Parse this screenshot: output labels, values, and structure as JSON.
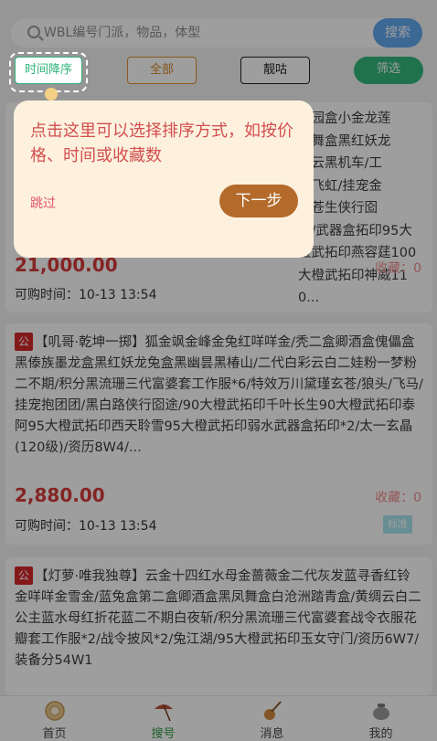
{
  "search": {
    "placeholder": "WBL编号门派，物品，体型",
    "button_label": "搜索"
  },
  "filters": {
    "time_desc": "时间降序",
    "all": "全部",
    "price": "靓咕",
    "screen": "筛选"
  },
  "cards": [
    {
      "title_visible": "游园盒小金龙莲\n圆舞盒黑红妖龙\n水云黑机车/工\n兔飞虹/挂宠金\n济苍生侠行囵\n返/武器盒拓印95大橙武拓印燕容莛100大橙武拓印神威110...",
      "price": "21,000.00",
      "collect": "收藏：0",
      "buy_time": "可购时间：10-13 13:54"
    },
    {
      "tag": "公",
      "title": "【叽哥·乾坤一掷】狐金飒金峰金兔红咩咩金/秃二盒卿酒盒傀儡盒黑傣族墨龙盒黑红妖龙兔盒黑幽昙黑椿山/二代白彩云白二娃粉一梦粉二不期/积分黑流珊三代富婆套工作服*6/特效万川黛瑾玄苍/狼头/飞马/挂宠抱团团/黑白路侠行囵途/90大橙武拓印千叶长生90大橙武拓印泰阿95大橙武拓印西天聆雪95大橙武拓印弱水武器盒拓印*2/太一玄晶(120级)/资历8W4/...",
      "price": "2,880.00",
      "collect": "收藏：0",
      "buy_time": "可购时间：10-13 13:54",
      "badge": "标准"
    },
    {
      "tag": "公",
      "title": "【灯萝·唯我独尊】云金十四红水母金蔷薇金二代灰发蓝寻香红铃金咩咩金雪金/蓝兔盒第二盒卿酒盒黑凤舞盒白沧洲踏青盒/黄绸云白二公主蓝水母红折花蓝二不期白夜斩/积分黑流珊三代富婆套战令衣服花瓣套工作服*2/战令披风*2/兔江湖/95大橙武拓印玉女守门/资历6W7/装备分54W1"
    }
  ],
  "guide": {
    "text": "点击这里可以选择排序方式，如按价格、时间或收藏数",
    "skip": "跳过",
    "next": "下一步"
  },
  "tabbar": {
    "items": [
      {
        "label": "首页",
        "icon": "home-coin-icon"
      },
      {
        "label": "搜号",
        "icon": "umbrella-icon",
        "active": true
      },
      {
        "label": "消息",
        "icon": "pipa-icon"
      },
      {
        "label": "我的",
        "icon": "pot-icon"
      }
    ]
  },
  "colors": {
    "accent_green": "#2fb47a",
    "price_red": "#d73a3a",
    "search_blue": "#62a9ef",
    "guide_brown": "#b46a2a"
  }
}
